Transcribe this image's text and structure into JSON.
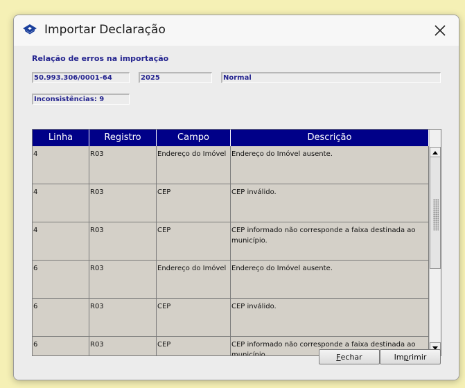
{
  "window": {
    "title": "Importar Declaração"
  },
  "section": {
    "title": "Relação de erros na importação"
  },
  "fields": {
    "cnpj": "50.993.306/0001-64",
    "year": "2025",
    "type": "Normal",
    "inconsistencies": "Inconsistências: 9"
  },
  "table": {
    "headers": [
      "Linha",
      "Registro",
      "Campo",
      "Descrição"
    ],
    "rows": [
      {
        "linha": "4",
        "registro": "R03",
        "campo": "Endereço do Imóvel",
        "descricao": "Endereço do Imóvel ausente."
      },
      {
        "linha": "4",
        "registro": "R03",
        "campo": "CEP",
        "descricao": "CEP inválido."
      },
      {
        "linha": "4",
        "registro": "R03",
        "campo": "CEP",
        "descricao": "CEP informado não corresponde a faixa destinada ao município."
      },
      {
        "linha": "6",
        "registro": "R03",
        "campo": "Endereço do Imóvel",
        "descricao": "Endereço do Imóvel ausente."
      },
      {
        "linha": "6",
        "registro": "R03",
        "campo": "CEP",
        "descricao": "CEP inválido."
      },
      {
        "linha": "6",
        "registro": "R03",
        "campo": "CEP",
        "descricao": "CEP informado não corresponde a faixa destinada ao município."
      }
    ]
  },
  "buttons": {
    "close_mnemonic": "F",
    "close_rest": "echar",
    "print_pre": "Im",
    "print_mnemonic": "p",
    "print_rest": "rimir"
  },
  "icons": {
    "app": "receita-federal-icon",
    "close": "close-icon",
    "scroll_up": "arrow-up-icon",
    "scroll_down": "arrow-down-icon"
  },
  "colors": {
    "header_bg": "#000088",
    "field_text": "#24248f",
    "row_bg": "#d4d0c8"
  }
}
